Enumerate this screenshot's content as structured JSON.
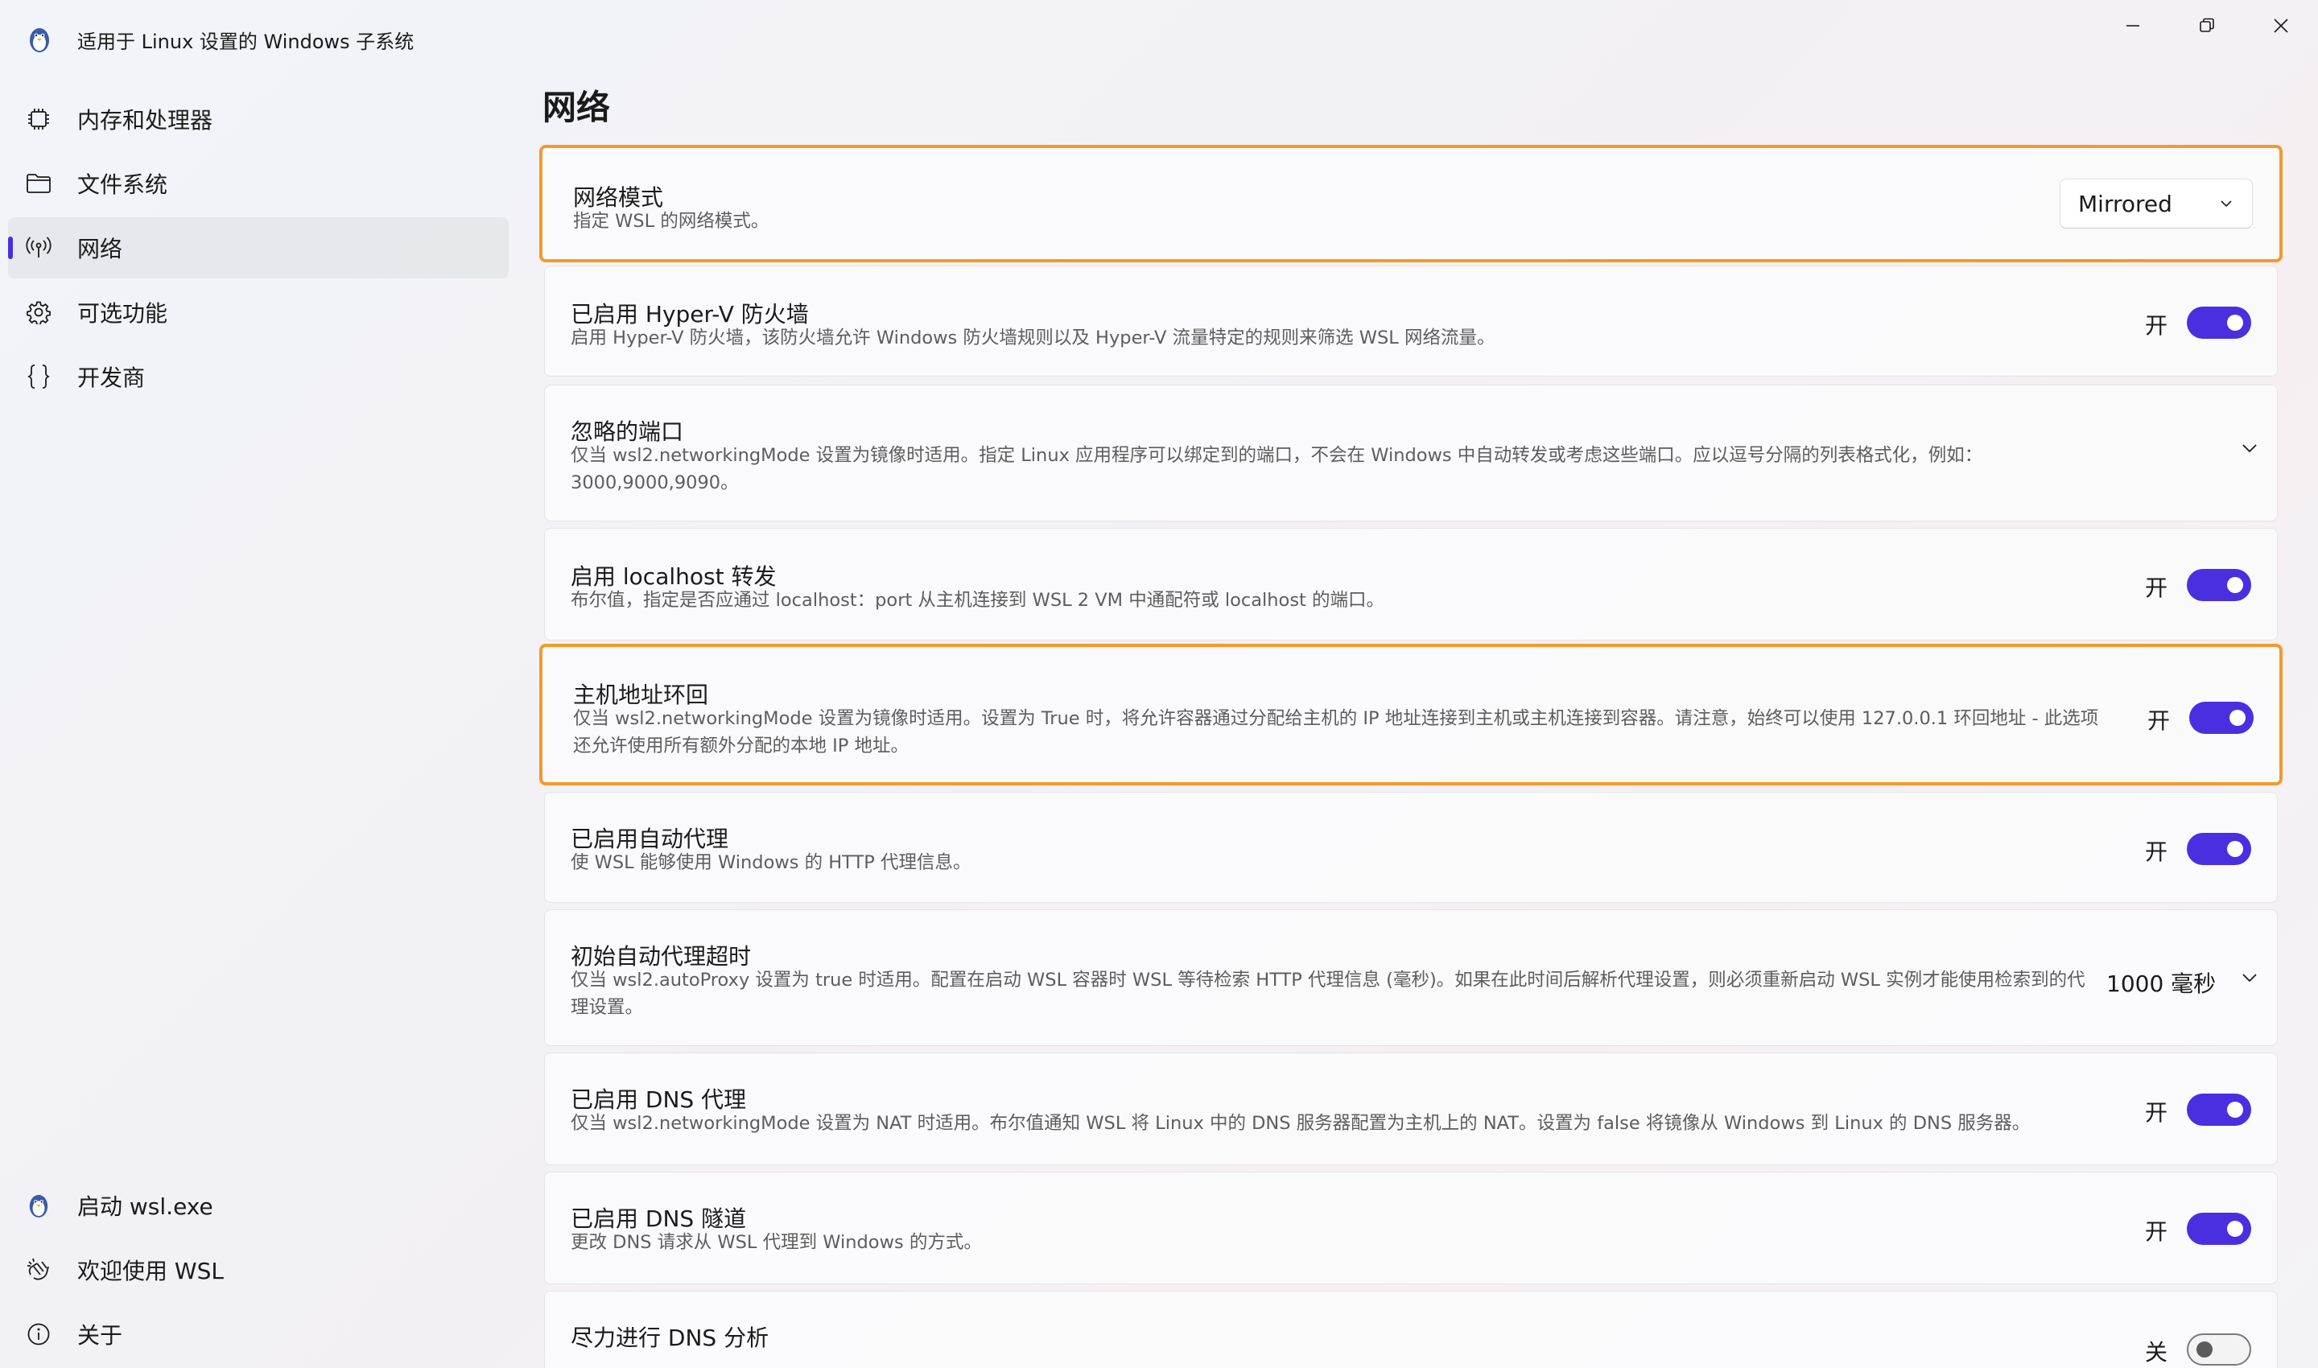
{
  "app": {
    "title": "适用于 Linux 设置的 Windows 子系统"
  },
  "window_controls": [
    "minimize-icon",
    "restore-icon",
    "close-icon"
  ],
  "sidebar": {
    "top_items": [
      {
        "label": "内存和处理器",
        "icon": "chip-icon"
      },
      {
        "label": "文件系统",
        "icon": "folder-icon"
      },
      {
        "label": "网络",
        "icon": "network-icon",
        "active": true
      },
      {
        "label": "可选功能",
        "icon": "gear-icon"
      },
      {
        "label": "开发商",
        "icon": "braces-icon"
      }
    ],
    "bottom_items": [
      {
        "label": "启动 wsl.exe",
        "icon": "penguin-icon"
      },
      {
        "label": "欢迎使用 WSL",
        "icon": "welcome-icon"
      },
      {
        "label": "关于",
        "icon": "info-icon"
      }
    ]
  },
  "main": {
    "title": "网络",
    "settings": [
      {
        "title": "网络模式",
        "desc": "指定 WSL 的网络模式。",
        "control": "dropdown",
        "value": "Mirrored",
        "highlighted": true
      },
      {
        "title": "已启用 Hyper-V 防火墙",
        "desc": "启用 Hyper-V 防火墙，该防火墙允许 Windows 防火墙规则以及 Hyper-V 流量特定的规则来筛选 WSL 网络流量。",
        "control": "toggle",
        "state": "开",
        "on": true
      },
      {
        "title": "忽略的端口",
        "desc": "仅当 wsl2.networkingMode 设置为镜像时适用。指定 Linux 应用程序可以绑定到的端口，不会在 Windows 中自动转发或考虑这些端口。应以逗号分隔的列表格式化，例如：3000,9000,9090。",
        "control": "expander"
      },
      {
        "title": "启用 localhost 转发",
        "desc": "布尔值，指定是否应通过 localhost：port 从主机连接到 WSL 2 VM 中通配符或 localhost 的端口。",
        "control": "toggle",
        "state": "开",
        "on": true
      },
      {
        "title": "主机地址环回",
        "desc": "仅当 wsl2.networkingMode 设置为镜像时适用。设置为 True 时，将允许容器通过分配给主机的 IP 地址连接到主机或主机连接到容器。请注意，始终可以使用 127.0.0.1 环回地址 - 此选项还允许使用所有额外分配的本地 IP 地址。",
        "control": "toggle",
        "state": "开",
        "on": true,
        "highlighted": true
      },
      {
        "title": "已启用自动代理",
        "desc": "使 WSL 能够使用 Windows 的 HTTP 代理信息。",
        "control": "toggle",
        "state": "开",
        "on": true
      },
      {
        "title": "初始自动代理超时",
        "desc": "仅当 wsl2.autoProxy 设置为 true 时适用。配置在启动 WSL 容器时 WSL 等待检索 HTTP 代理信息 (毫秒)。如果在此时间后解析代理设置，则必须重新启动 WSL 实例才能使用检索到的代理设置。",
        "control": "value-expander",
        "value": "1000 毫秒"
      },
      {
        "title": "已启用 DNS 代理",
        "desc": "仅当 wsl2.networkingMode 设置为 NAT 时适用。布尔值通知 WSL 将 Linux 中的 DNS 服务器配置为主机上的 NAT。设置为 false 将镜像从 Windows 到 Linux 的 DNS 服务器。",
        "control": "toggle",
        "state": "开",
        "on": true
      },
      {
        "title": "已启用 DNS 隧道",
        "desc": "更改 DNS 请求从 WSL 代理到 Windows 的方式。",
        "control": "toggle",
        "state": "开",
        "on": true
      },
      {
        "title": "尽力进行 DNS 分析",
        "desc": "",
        "control": "toggle",
        "state": "关",
        "on": false
      }
    ]
  },
  "colors": {
    "accent": "#4a2fe0",
    "highlight_border": "#f39a2b"
  }
}
